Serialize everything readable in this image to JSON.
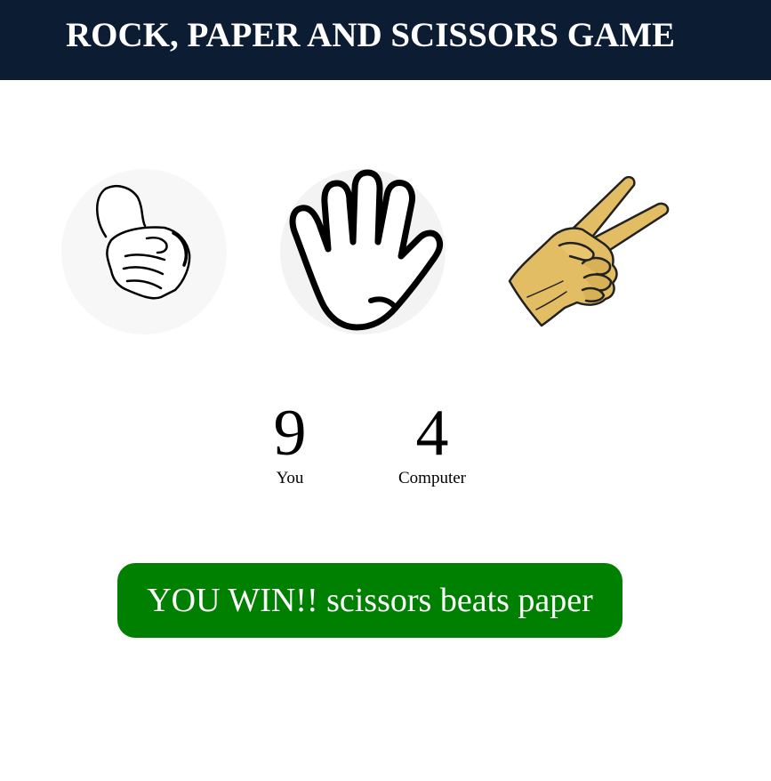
{
  "header": {
    "title": "ROCK, PAPER AND SCISSORS GAME"
  },
  "choices": [
    {
      "id": "rock",
      "icon": "rock-fist-icon"
    },
    {
      "id": "paper",
      "icon": "paper-open-hand-icon"
    },
    {
      "id": "scissors",
      "icon": "scissors-peace-hand-icon"
    }
  ],
  "scoreboard": {
    "user": {
      "score": "9",
      "label": "You"
    },
    "computer": {
      "score": "4",
      "label": "Computer"
    }
  },
  "result": {
    "message": "YOU WIN!! scissors beats paper",
    "color": "#008000"
  },
  "colors": {
    "header_bg": "#0b1c33",
    "choice_bg": "#f6f6f6",
    "scissors_skin": "#e2bd63"
  }
}
